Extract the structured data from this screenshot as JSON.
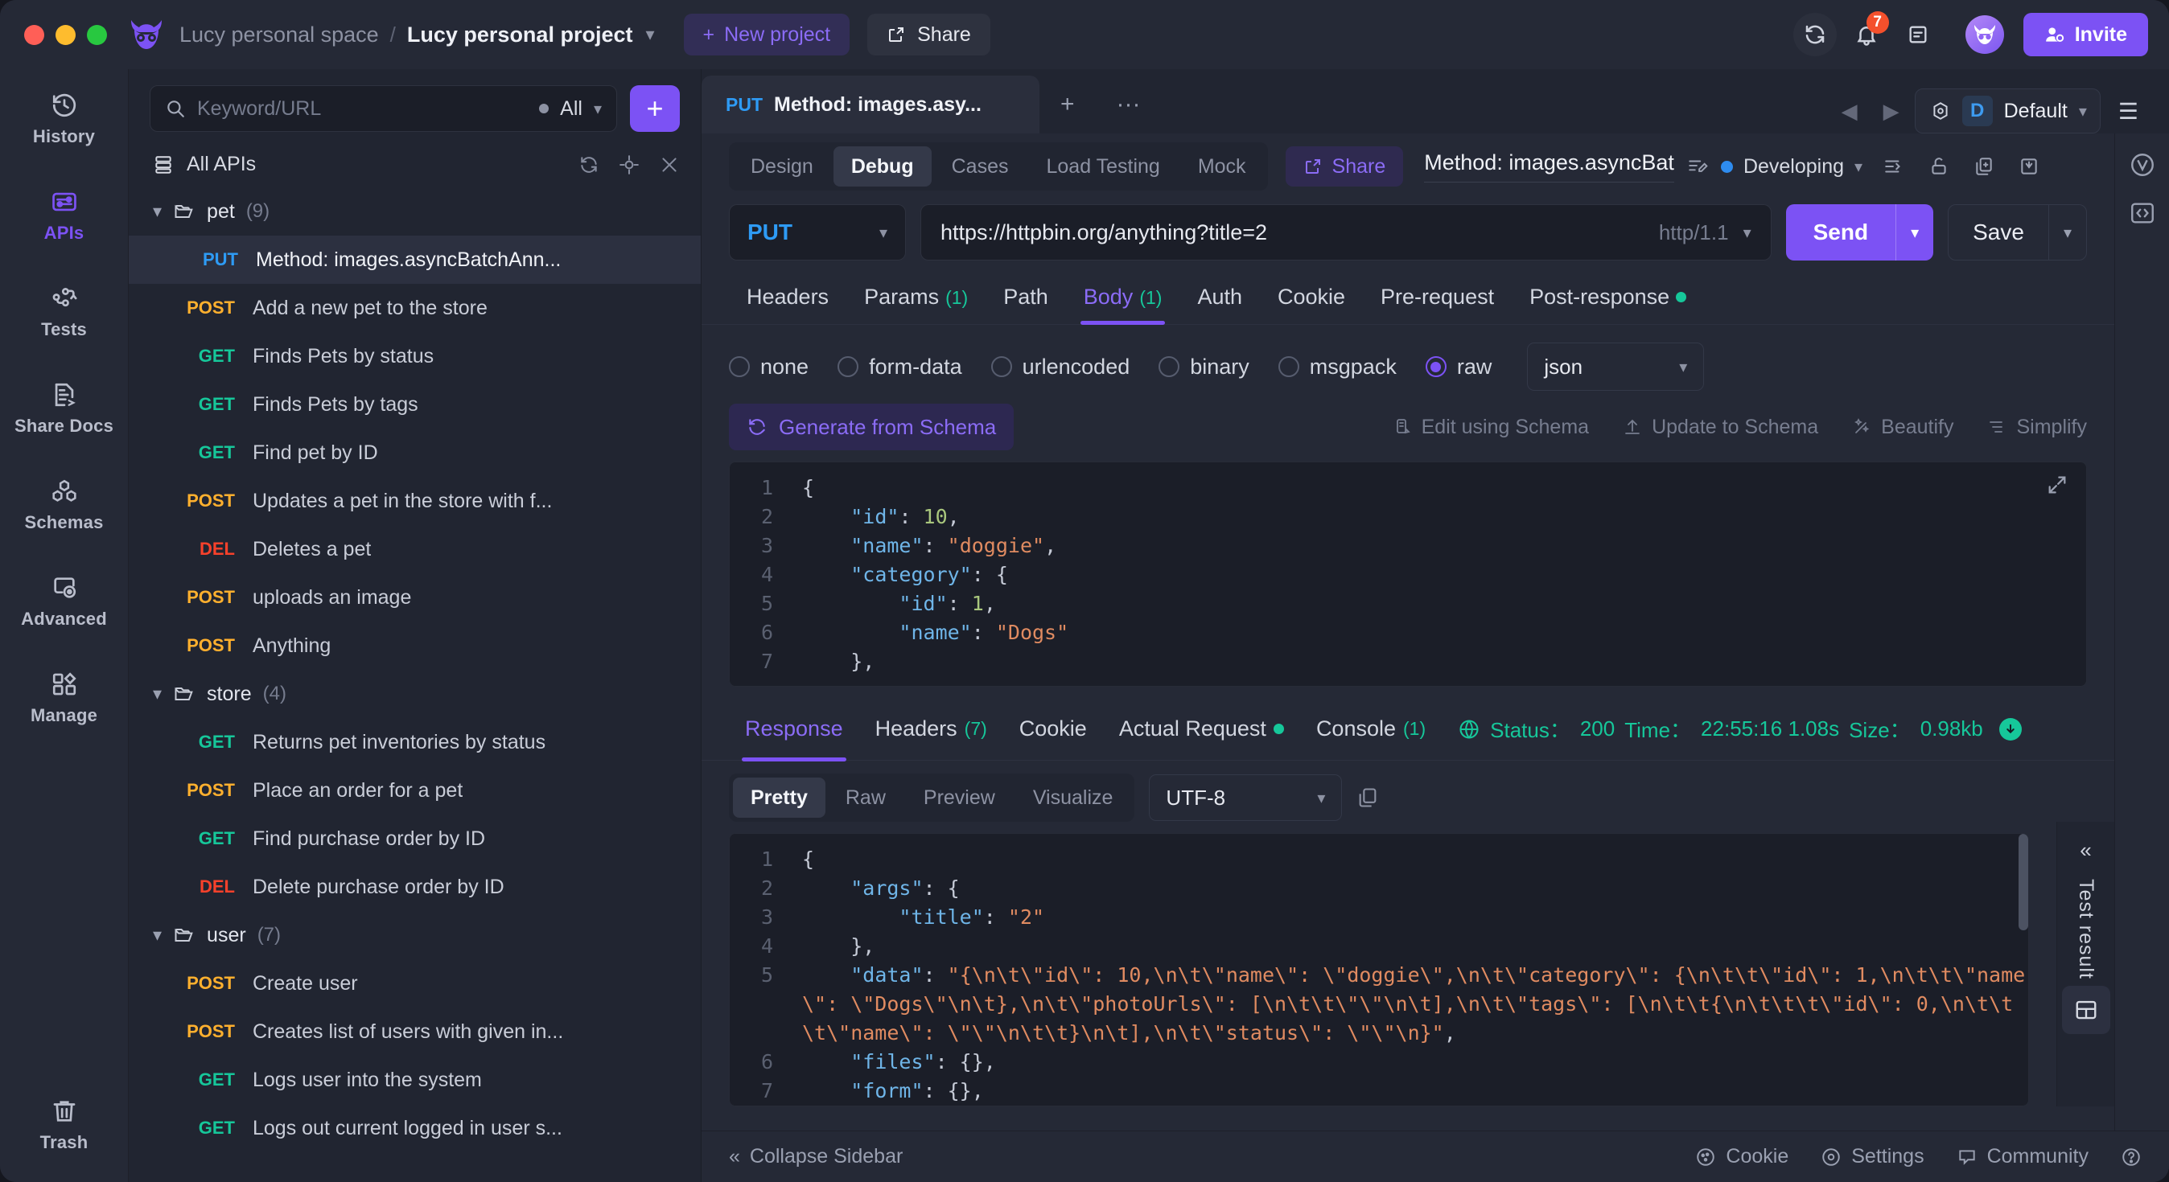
{
  "titlebar": {
    "workspace": "Lucy personal space",
    "separator": "/",
    "project": "Lucy personal project",
    "new_project_label": "New project",
    "share_label": "Share",
    "notification_badge": "7",
    "invite_label": "Invite"
  },
  "rail": {
    "items": [
      {
        "label": "History",
        "icon": "history-icon",
        "active": false
      },
      {
        "label": "APIs",
        "icon": "apis-icon",
        "active": true
      },
      {
        "label": "Tests",
        "icon": "tests-icon",
        "active": false
      },
      {
        "label": "Share Docs",
        "icon": "share-docs-icon",
        "active": false
      },
      {
        "label": "Schemas",
        "icon": "schemas-icon",
        "active": false
      },
      {
        "label": "Advanced",
        "icon": "advanced-icon",
        "active": false
      },
      {
        "label": "Manage",
        "icon": "manage-icon",
        "active": false
      }
    ],
    "trash_label": "Trash"
  },
  "tree": {
    "search_placeholder": "Keyword/URL",
    "search_value": "",
    "filter_label": "All",
    "add_label": "+",
    "root_label": "All APIs",
    "folders": [
      {
        "name": "pet",
        "count": "(9)",
        "items": [
          {
            "method": "PUT",
            "name": "Method: images.asyncBatchAnn...",
            "selected": true
          },
          {
            "method": "POST",
            "name": "Add a new pet to the store",
            "selected": false
          },
          {
            "method": "GET",
            "name": "Finds Pets by status",
            "selected": false
          },
          {
            "method": "GET",
            "name": "Finds Pets by tags",
            "selected": false
          },
          {
            "method": "GET",
            "name": "Find pet by ID",
            "selected": false
          },
          {
            "method": "POST",
            "name": "Updates a pet in the store with f...",
            "selected": false
          },
          {
            "method": "DEL",
            "name": "Deletes a pet",
            "selected": false
          },
          {
            "method": "POST",
            "name": "uploads an image",
            "selected": false
          },
          {
            "method": "POST",
            "name": "Anything",
            "selected": false
          }
        ]
      },
      {
        "name": "store",
        "count": "(4)",
        "items": [
          {
            "method": "GET",
            "name": "Returns pet inventories by status",
            "selected": false
          },
          {
            "method": "POST",
            "name": "Place an order for a pet",
            "selected": false
          },
          {
            "method": "GET",
            "name": "Find purchase order by ID",
            "selected": false
          },
          {
            "method": "DEL",
            "name": "Delete purchase order by ID",
            "selected": false
          }
        ]
      },
      {
        "name": "user",
        "count": "(7)",
        "items": [
          {
            "method": "POST",
            "name": "Create user",
            "selected": false
          },
          {
            "method": "POST",
            "name": "Creates list of users with given in...",
            "selected": false
          },
          {
            "method": "GET",
            "name": "Logs user into the system",
            "selected": false
          },
          {
            "method": "GET",
            "name": "Logs out current logged in user s...",
            "selected": false
          }
        ]
      }
    ]
  },
  "doc_tab": {
    "method": "PUT",
    "title": "Method: images.asy...",
    "add_label": "+",
    "more_label": "···"
  },
  "env": {
    "initial": "D",
    "name": "Default"
  },
  "modes": {
    "tabs": [
      {
        "label": "Design",
        "active": false
      },
      {
        "label": "Debug",
        "active": true
      },
      {
        "label": "Cases",
        "active": false
      },
      {
        "label": "Load Testing",
        "active": false
      },
      {
        "label": "Mock",
        "active": false
      }
    ],
    "share_label": "Share"
  },
  "api_title": {
    "value": "Method: images.asyncBat",
    "status": "Developing"
  },
  "request": {
    "method": "PUT",
    "url": "https://httpbin.org/anything?title=2",
    "protocol": "http/1.1",
    "send_label": "Send",
    "save_label": "Save",
    "tabs": [
      {
        "label": "Headers",
        "count": "",
        "active": false,
        "dot": false
      },
      {
        "label": "Params",
        "count": "(1)",
        "active": false,
        "dot": false
      },
      {
        "label": "Path",
        "count": "",
        "active": false,
        "dot": false
      },
      {
        "label": "Body",
        "count": "(1)",
        "active": true,
        "dot": false
      },
      {
        "label": "Auth",
        "count": "",
        "active": false,
        "dot": false
      },
      {
        "label": "Cookie",
        "count": "",
        "active": false,
        "dot": false
      },
      {
        "label": "Pre-request",
        "count": "",
        "active": false,
        "dot": false
      },
      {
        "label": "Post-response",
        "count": "",
        "active": false,
        "dot": true
      }
    ],
    "body_types": [
      {
        "label": "none",
        "selected": false
      },
      {
        "label": "form-data",
        "selected": false
      },
      {
        "label": "urlencoded",
        "selected": false
      },
      {
        "label": "binary",
        "selected": false
      },
      {
        "label": "msgpack",
        "selected": false
      },
      {
        "label": "raw",
        "selected": true
      }
    ],
    "raw_format": "json",
    "generate_schema_label": "Generate from Schema",
    "schema_actions": [
      {
        "label": "Edit using Schema",
        "icon": "edit-schema-icon"
      },
      {
        "label": "Update to Schema",
        "icon": "upload-icon"
      },
      {
        "label": "Beautify",
        "icon": "wand-icon"
      },
      {
        "label": "Simplify",
        "icon": "list-icon"
      }
    ],
    "body_lines": [
      {
        "num": "1",
        "tokens": [
          {
            "t": "p",
            "v": "{"
          }
        ]
      },
      {
        "num": "2",
        "tokens": [
          {
            "t": "p",
            "v": "    "
          },
          {
            "t": "k",
            "v": "\"id\""
          },
          {
            "t": "p",
            "v": ": "
          },
          {
            "t": "n",
            "v": "10"
          },
          {
            "t": "p",
            "v": ","
          }
        ]
      },
      {
        "num": "3",
        "tokens": [
          {
            "t": "p",
            "v": "    "
          },
          {
            "t": "k",
            "v": "\"name\""
          },
          {
            "t": "p",
            "v": ": "
          },
          {
            "t": "s",
            "v": "\"doggie\""
          },
          {
            "t": "p",
            "v": ","
          }
        ]
      },
      {
        "num": "4",
        "tokens": [
          {
            "t": "p",
            "v": "    "
          },
          {
            "t": "k",
            "v": "\"category\""
          },
          {
            "t": "p",
            "v": ": {"
          }
        ]
      },
      {
        "num": "5",
        "tokens": [
          {
            "t": "p",
            "v": "        "
          },
          {
            "t": "k",
            "v": "\"id\""
          },
          {
            "t": "p",
            "v": ": "
          },
          {
            "t": "n",
            "v": "1"
          },
          {
            "t": "p",
            "v": ","
          }
        ]
      },
      {
        "num": "6",
        "tokens": [
          {
            "t": "p",
            "v": "        "
          },
          {
            "t": "k",
            "v": "\"name\""
          },
          {
            "t": "p",
            "v": ": "
          },
          {
            "t": "s",
            "v": "\"Dogs\""
          }
        ]
      },
      {
        "num": "7",
        "tokens": [
          {
            "t": "p",
            "v": "    },"
          }
        ]
      }
    ]
  },
  "response": {
    "tabs": [
      {
        "label": "Response",
        "count": "",
        "active": true,
        "dot": false
      },
      {
        "label": "Headers",
        "count": "(7)",
        "active": false,
        "dot": false
      },
      {
        "label": "Cookie",
        "count": "",
        "active": false,
        "dot": false
      },
      {
        "label": "Actual Request",
        "count": "",
        "active": false,
        "dot": true
      },
      {
        "label": "Console",
        "count": "(1)",
        "active": false,
        "dot": false
      }
    ],
    "status_label": "Status：",
    "status_value": "200",
    "time_label": "Time：",
    "time_value": "22:55:16 1.08s",
    "size_label": "Size：",
    "size_value": "0.98kb",
    "view_tabs": [
      {
        "label": "Pretty",
        "active": true
      },
      {
        "label": "Raw",
        "active": false
      },
      {
        "label": "Preview",
        "active": false
      },
      {
        "label": "Visualize",
        "active": false
      }
    ],
    "encoding": "UTF-8",
    "body_lines": [
      {
        "num": "1",
        "wrap": false,
        "tokens": [
          {
            "t": "p",
            "v": "{"
          }
        ]
      },
      {
        "num": "2",
        "wrap": false,
        "tokens": [
          {
            "t": "p",
            "v": "    "
          },
          {
            "t": "k",
            "v": "\"args\""
          },
          {
            "t": "p",
            "v": ": {"
          }
        ]
      },
      {
        "num": "3",
        "wrap": false,
        "tokens": [
          {
            "t": "p",
            "v": "        "
          },
          {
            "t": "k",
            "v": "\"title\""
          },
          {
            "t": "p",
            "v": ": "
          },
          {
            "t": "s",
            "v": "\"2\""
          }
        ]
      },
      {
        "num": "4",
        "wrap": false,
        "tokens": [
          {
            "t": "p",
            "v": "    },"
          }
        ]
      },
      {
        "num": "5",
        "wrap": true,
        "tokens": [
          {
            "t": "p",
            "v": "    "
          },
          {
            "t": "k",
            "v": "\"data\""
          },
          {
            "t": "p",
            "v": ": "
          },
          {
            "t": "s",
            "v": "\"{\\n\\t\\\"id\\\": 10,\\n\\t\\\"name\\\": \\\"doggie\\\",\\n\\t\\\"category\\\": {\\n\\t\\t\\\"id\\\": 1,\\n\\t\\t\\\"name\\\": \\\"Dogs\\\"\\n\\t},\\n\\t\\\"photoUrls\\\": [\\n\\t\\t\\\"\\\"\\n\\t],\\n\\t\\\"tags\\\": [\\n\\t\\t{\\n\\t\\t\\t\\\"id\\\": 0,\\n\\t\\t\\t\\\"name\\\": \\\"\\\"\\n\\t\\t}\\n\\t],\\n\\t\\\"status\\\": \\\"\\\"\\n}\""
          },
          {
            "t": "p",
            "v": ","
          }
        ]
      },
      {
        "num": "6",
        "wrap": false,
        "tokens": [
          {
            "t": "p",
            "v": "    "
          },
          {
            "t": "k",
            "v": "\"files\""
          },
          {
            "t": "p",
            "v": ": {},"
          }
        ]
      },
      {
        "num": "7",
        "wrap": false,
        "tokens": [
          {
            "t": "p",
            "v": "    "
          },
          {
            "t": "k",
            "v": "\"form\""
          },
          {
            "t": "p",
            "v": ": {},"
          }
        ]
      }
    ],
    "test_result_label": "Test result"
  },
  "statusbar": {
    "collapse_label": "Collapse Sidebar",
    "items": [
      {
        "label": "Cookie",
        "icon": "cookie-icon"
      },
      {
        "label": "Settings",
        "icon": "gear-icon"
      },
      {
        "label": "Community",
        "icon": "community-icon"
      }
    ],
    "help_icon": "help-icon"
  },
  "colors": {
    "accent": "#7c52f4",
    "green": "#16c79a",
    "blue": "#2e9bf5",
    "orange": "#ffb02e",
    "red": "#f8412b"
  }
}
